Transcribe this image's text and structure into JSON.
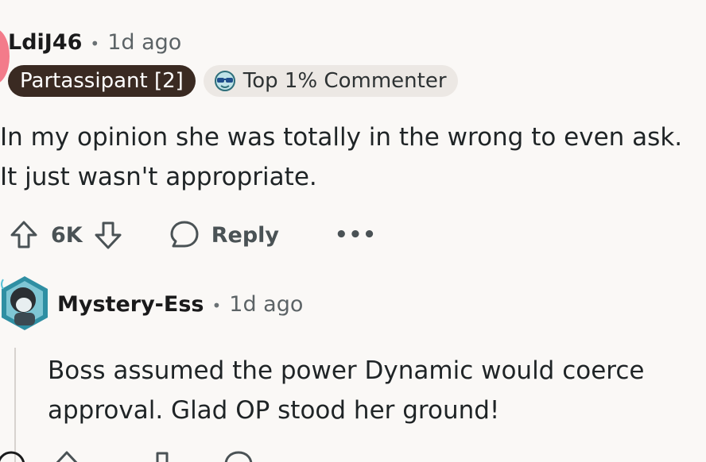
{
  "comment": {
    "author": "LdiJ46",
    "separator": "•",
    "time": "1d ago",
    "flairs": [
      {
        "label": "Partassipant [2]"
      },
      {
        "label": "Top 1% Commenter",
        "icon": "sunglasses-icon"
      }
    ],
    "body": "In my opinion she was totally in the wrong to even ask. It just wasn't appropriate.",
    "votes": "6K",
    "reply_label": "Reply",
    "more_label": "•••"
  },
  "reply": {
    "author": "Mystery-Ess",
    "separator": "•",
    "time": "1d ago",
    "body": "Boss assumed the power Dynamic would coerce approval. Glad OP stood her ground!"
  },
  "colors": {
    "background": "#faf8f6",
    "text": "#1a1a1b",
    "muted": "#5c6366",
    "flair_dark": "#3a2a22",
    "flair_light": "#ece8e4",
    "avatar_pink": "#f37b8a"
  }
}
